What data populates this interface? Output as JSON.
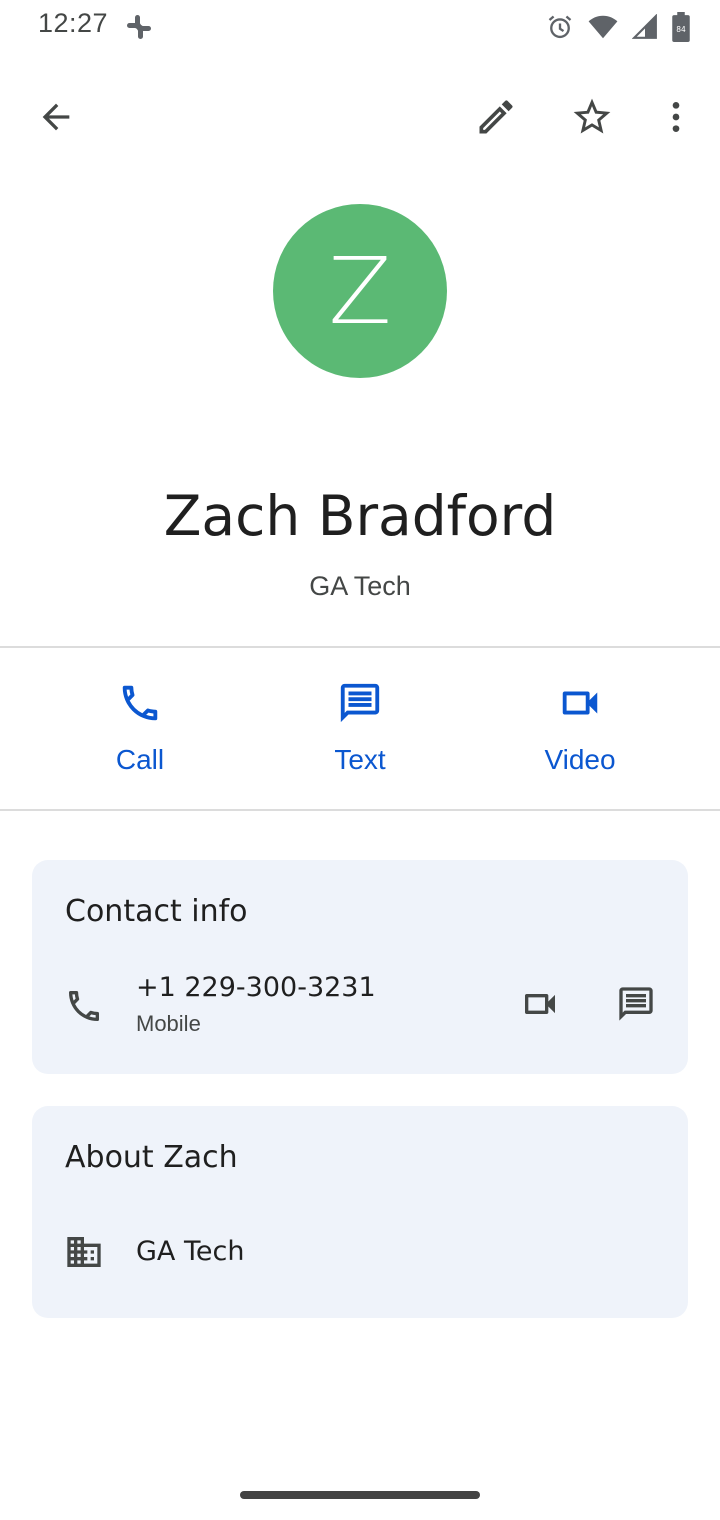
{
  "status_bar": {
    "time": "12:27",
    "icons": [
      "slack-icon",
      "alarm-icon",
      "wifi-icon",
      "cell-signal-icon",
      "battery-icon"
    ],
    "battery_level": "84"
  },
  "toolbar": {
    "back_icon": "arrow-back-icon",
    "edit_icon": "edit-pencil-icon",
    "star_icon": "star-outline-icon",
    "more_icon": "more-vert-icon"
  },
  "contact": {
    "initial": "Z",
    "name": "Zach Bradford",
    "company": "GA Tech",
    "avatar_color": "#5bb974"
  },
  "actions": [
    {
      "label": "Call",
      "icon": "phone-icon"
    },
    {
      "label": "Text",
      "icon": "message-icon"
    },
    {
      "label": "Video",
      "icon": "videocam-icon"
    }
  ],
  "contact_info": {
    "title": "Contact info",
    "phone": {
      "number": "+1 229-300-3231",
      "type": "Mobile"
    }
  },
  "about": {
    "title": "About Zach",
    "company": "GA Tech"
  },
  "colors": {
    "accent": "#0b57d0",
    "card_background": "#eff3fa",
    "icon_gray": "#444746"
  }
}
